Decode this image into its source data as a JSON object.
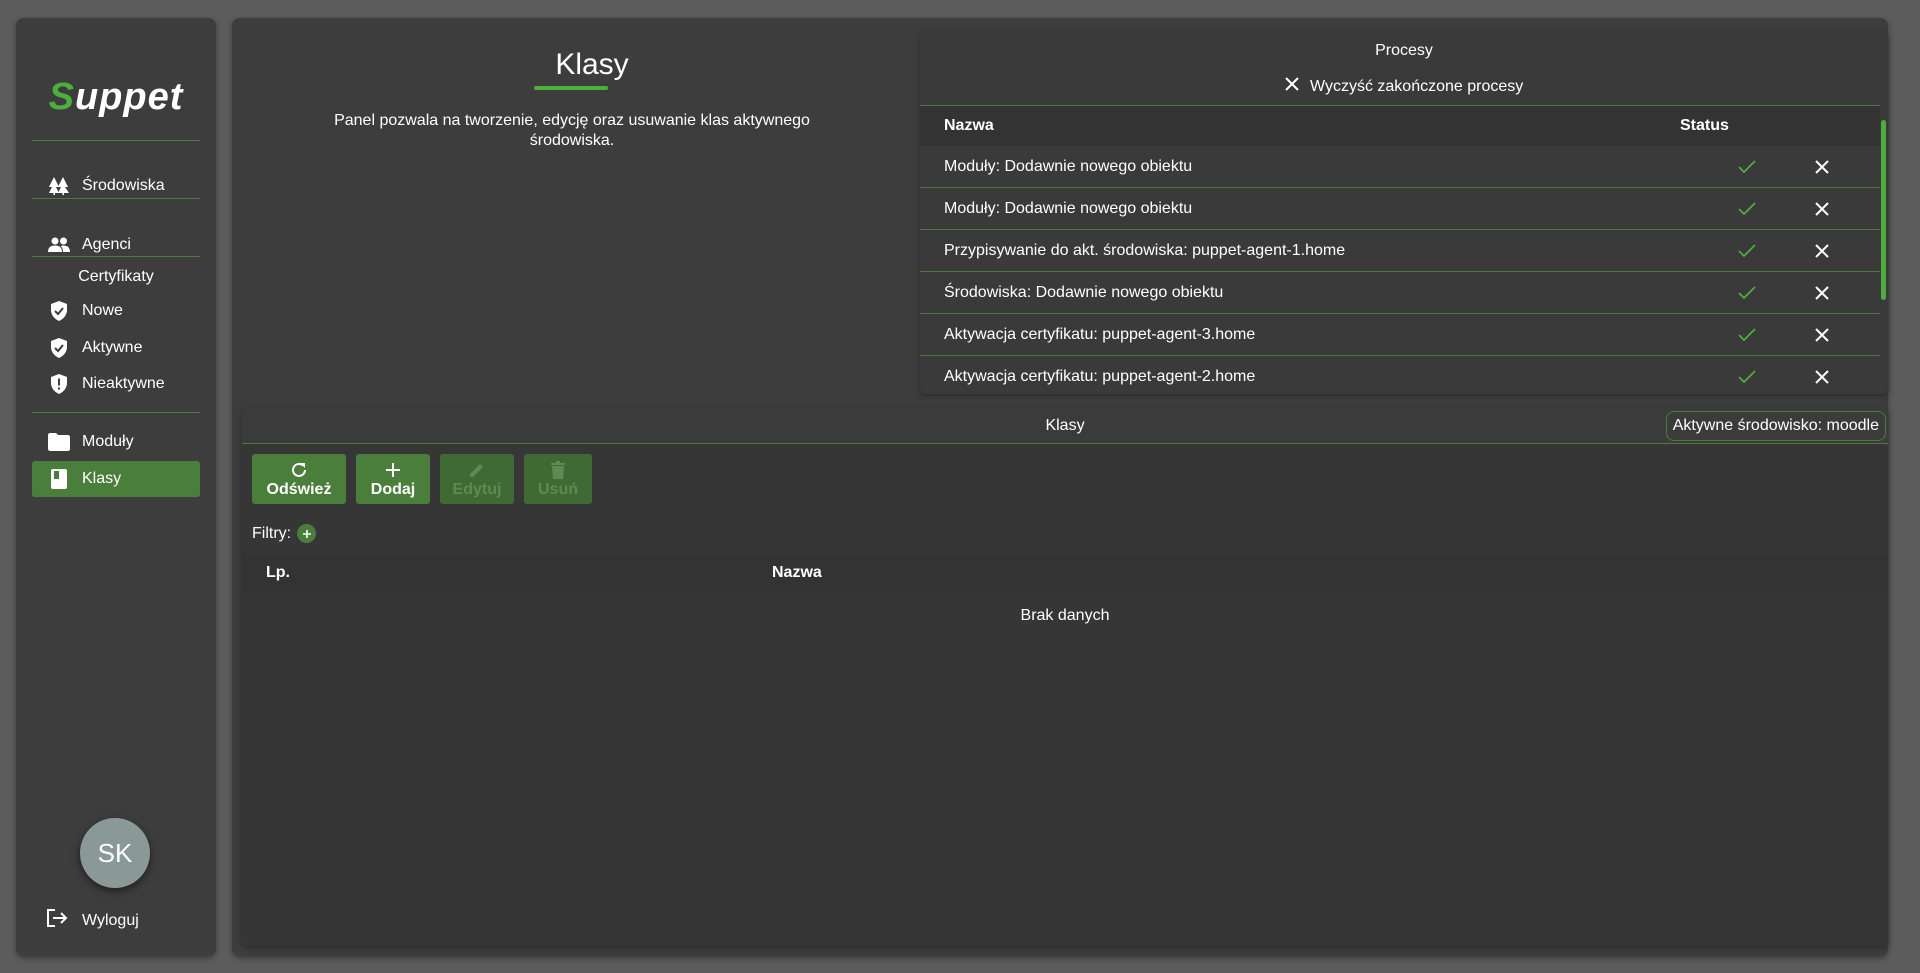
{
  "app": {
    "logo_first": "S",
    "logo_rest": "uppet"
  },
  "sidebar": {
    "items": [
      {
        "label": "Środowiska",
        "icon": "trees-icon"
      },
      {
        "label": "Agenci",
        "icon": "people-icon"
      }
    ],
    "certificates_label": "Certyfikaty",
    "cert_items": [
      {
        "label": "Nowe",
        "icon": "shield-check-icon"
      },
      {
        "label": "Aktywne",
        "icon": "shield-check-icon"
      },
      {
        "label": "Nieaktywne",
        "icon": "shield-alert-icon"
      }
    ],
    "bottom_items": [
      {
        "label": "Moduły",
        "icon": "folder-icon",
        "active": false
      },
      {
        "label": "Klasy",
        "icon": "book-icon",
        "active": true
      }
    ],
    "avatar_initials": "SK",
    "logout_label": "Wyloguj"
  },
  "header": {
    "title": "Klasy",
    "description": "Panel pozwala na tworzenie, edycję oraz usuwanie klas aktywnego środowiska."
  },
  "processes": {
    "title": "Procesy",
    "clear_label": "Wyczyść zakończone procesy",
    "columns": {
      "name": "Nazwa",
      "status": "Status"
    },
    "rows": [
      {
        "name": "Moduły: Dodawnie nowego obiektu",
        "status": "done"
      },
      {
        "name": "Moduły: Dodawnie nowego obiektu",
        "status": "done"
      },
      {
        "name": "Przypisywanie do akt. środowiska: puppet-agent-1.home",
        "status": "done"
      },
      {
        "name": "Środowiska: Dodawnie nowego obiektu",
        "status": "done"
      },
      {
        "name": "Aktywacja certyfikatu: puppet-agent-3.home",
        "status": "done"
      },
      {
        "name": "Aktywacja certyfikatu: puppet-agent-2.home",
        "status": "done"
      }
    ]
  },
  "classes": {
    "title": "Klasy",
    "active_env": "Aktywne środowisko: moodle",
    "toolbar": {
      "refresh": "Odśwież",
      "add": "Dodaj",
      "edit": "Edytuj",
      "delete": "Usuń"
    },
    "filters_label": "Filtry:",
    "columns": {
      "lp": "Lp.",
      "name": "Nazwa"
    },
    "empty_text": "Brak danych"
  },
  "colors": {
    "accent": "#4a7f3b",
    "accent_bright": "#4caf3a",
    "panel": "#3d3d3d",
    "background": "#5c5c5c"
  }
}
